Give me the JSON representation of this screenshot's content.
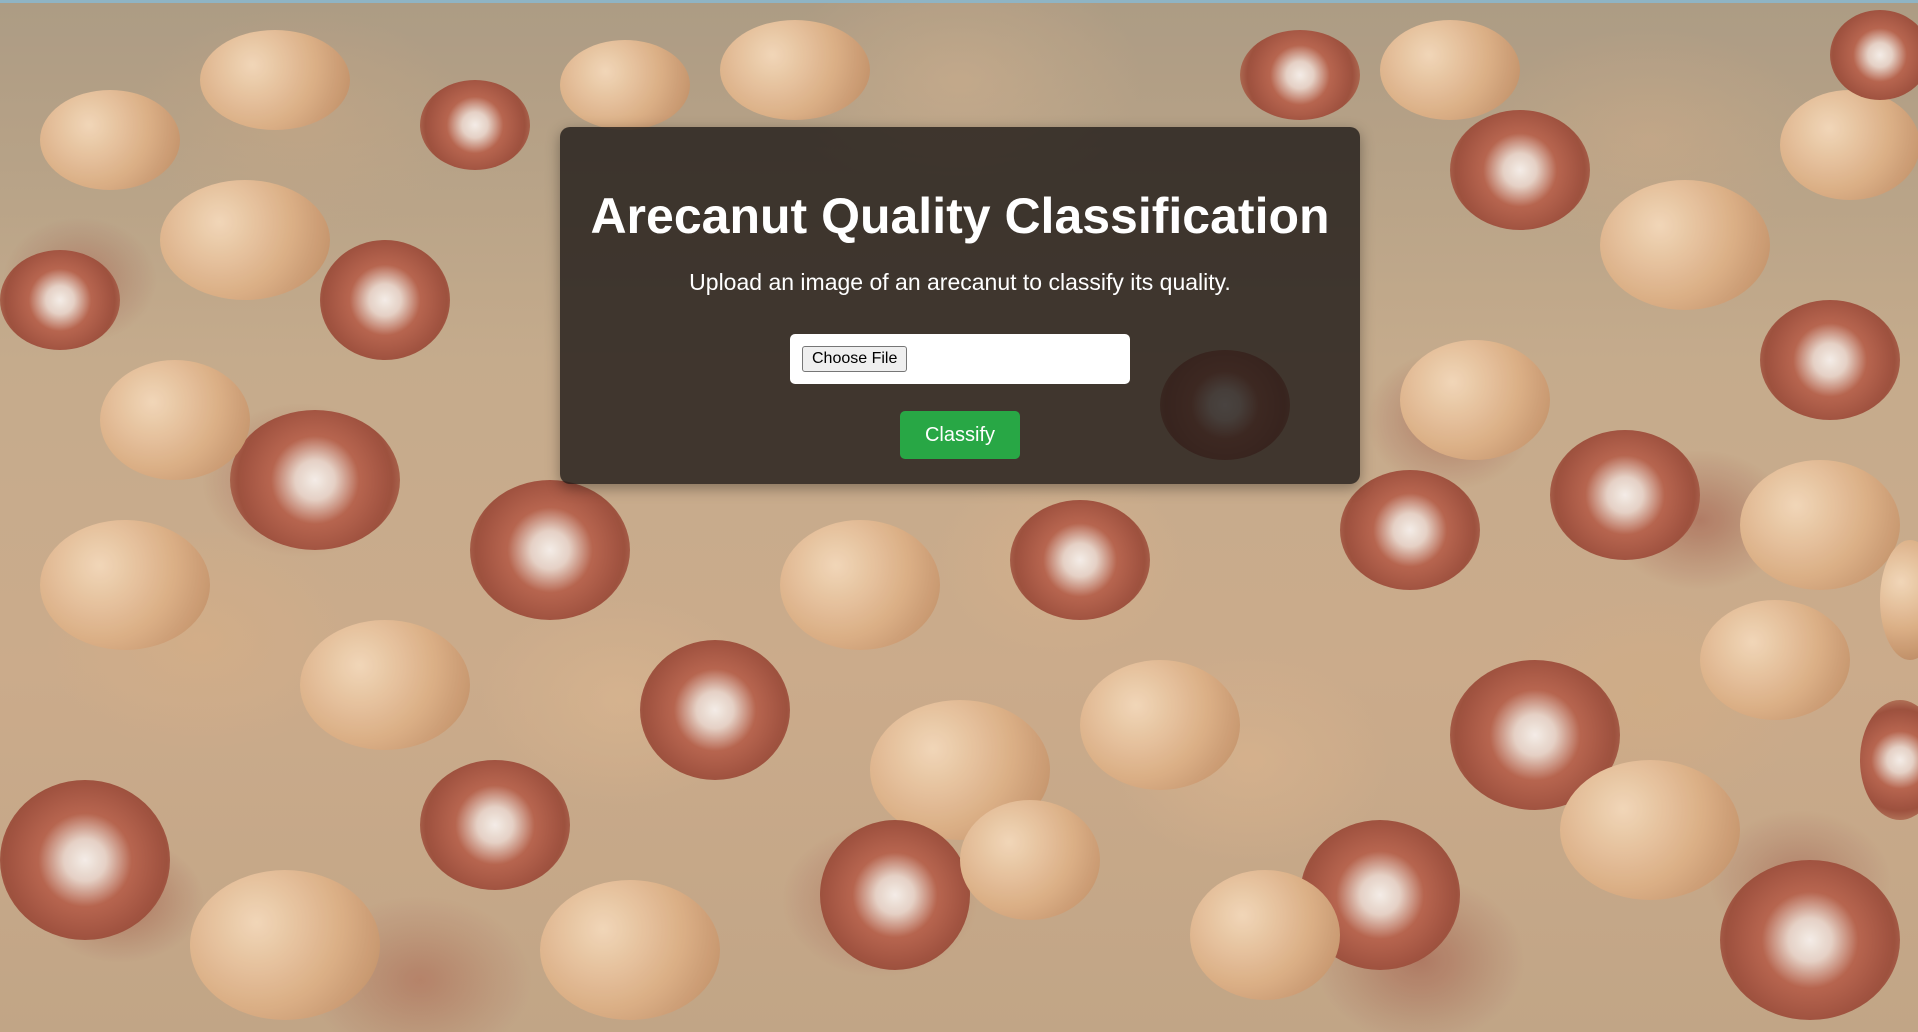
{
  "page": {
    "title": "Arecanut Quality Classification",
    "subtitle": "Upload an image of an arecanut to classify its quality."
  },
  "form": {
    "file_button_label": "Choose File",
    "submit_label": "Classify"
  },
  "colors": {
    "card_background": "#1e1916",
    "submit_background": "#28a745",
    "text": "#ffffff"
  },
  "background": {
    "description_icon": "arecanut-photo-background"
  }
}
